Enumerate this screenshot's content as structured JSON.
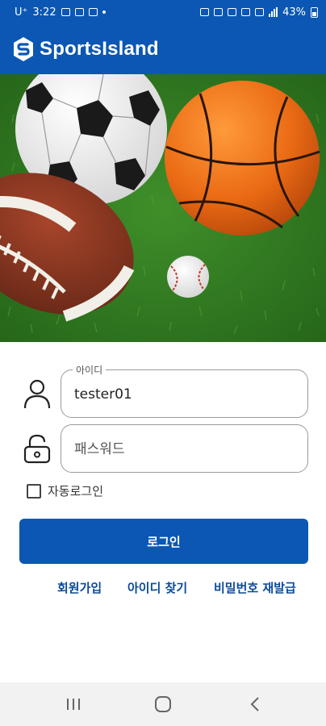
{
  "status_bar": {
    "carrier": "U⁺",
    "time": "3:22",
    "battery": "43%"
  },
  "app_bar": {
    "title": "SportsIsland",
    "logo_icon": "s-logo-icon"
  },
  "hero": {
    "image": "sports-balls-on-grass",
    "items": [
      "soccer-ball",
      "basketball",
      "american-football",
      "baseball"
    ]
  },
  "login_form": {
    "id_field": {
      "label": "아이디",
      "value": "tester01",
      "icon": "person-icon"
    },
    "password_field": {
      "placeholder": "패스워드",
      "value": "",
      "icon": "unlock-icon"
    },
    "auto_login": {
      "label": "자동로그인",
      "checked": false
    },
    "login_button": "로그인"
  },
  "links": {
    "signup": "회원가입",
    "find_id": "아이디 찾기",
    "reset_password": "비밀번호 재발급"
  },
  "nav_bar": {
    "buttons": [
      "recents-icon",
      "home-icon",
      "back-icon"
    ]
  },
  "colors": {
    "brand_blue": "#0b57b3",
    "link_blue": "#0b4a99",
    "grass_green": "#2f7a22"
  }
}
